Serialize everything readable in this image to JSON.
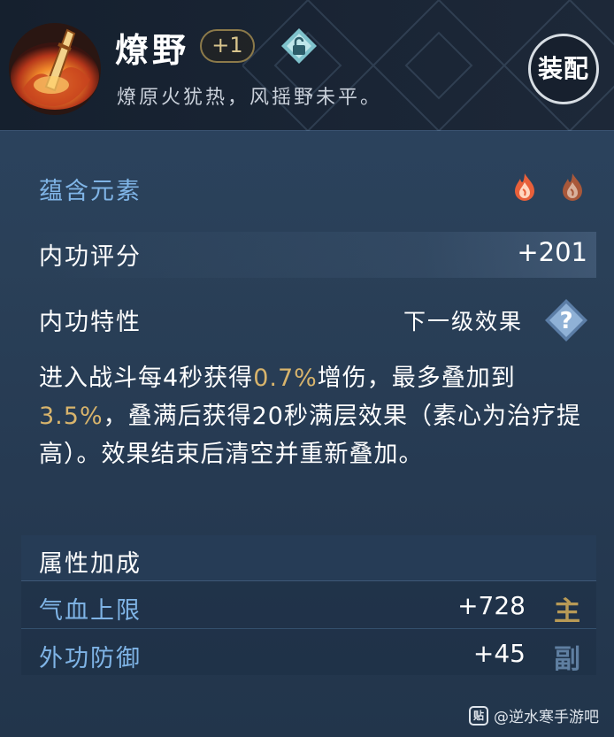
{
  "item": {
    "name": "燎野",
    "level": "+1",
    "description": "燎原火犹热，风摇野未平。",
    "equip_label": "装配"
  },
  "elements": {
    "label": "蕴含元素",
    "icons": [
      "fire-element-icon",
      "fire-element-icon"
    ]
  },
  "score": {
    "label": "内功评分",
    "value": "+201"
  },
  "trait": {
    "label": "内功特性",
    "next_level_label": "下一级效果",
    "desc_part1": "进入战斗每4秒获得",
    "highlight1": "0.7%",
    "desc_part2": "增伤，最多叠加到",
    "highlight2": "3.5%",
    "desc_part3": "，叠满后获得20秒满层效果（素心为治疗提高）。效果结束后清空并重新叠加。"
  },
  "attributes": {
    "header": "属性加成",
    "rows": [
      {
        "name": "气血上限",
        "value": "+728",
        "tag": "主"
      },
      {
        "name": "外功防御",
        "value": "+45",
        "tag": "副"
      }
    ]
  },
  "watermark": {
    "text": "@逆水寒手游吧",
    "icon_label": "贴"
  },
  "colors": {
    "highlight": "#d8b46c",
    "section_label": "#7fb4e6",
    "tag_main": "#b89a56",
    "tag_sub": "#5f7fa1"
  }
}
